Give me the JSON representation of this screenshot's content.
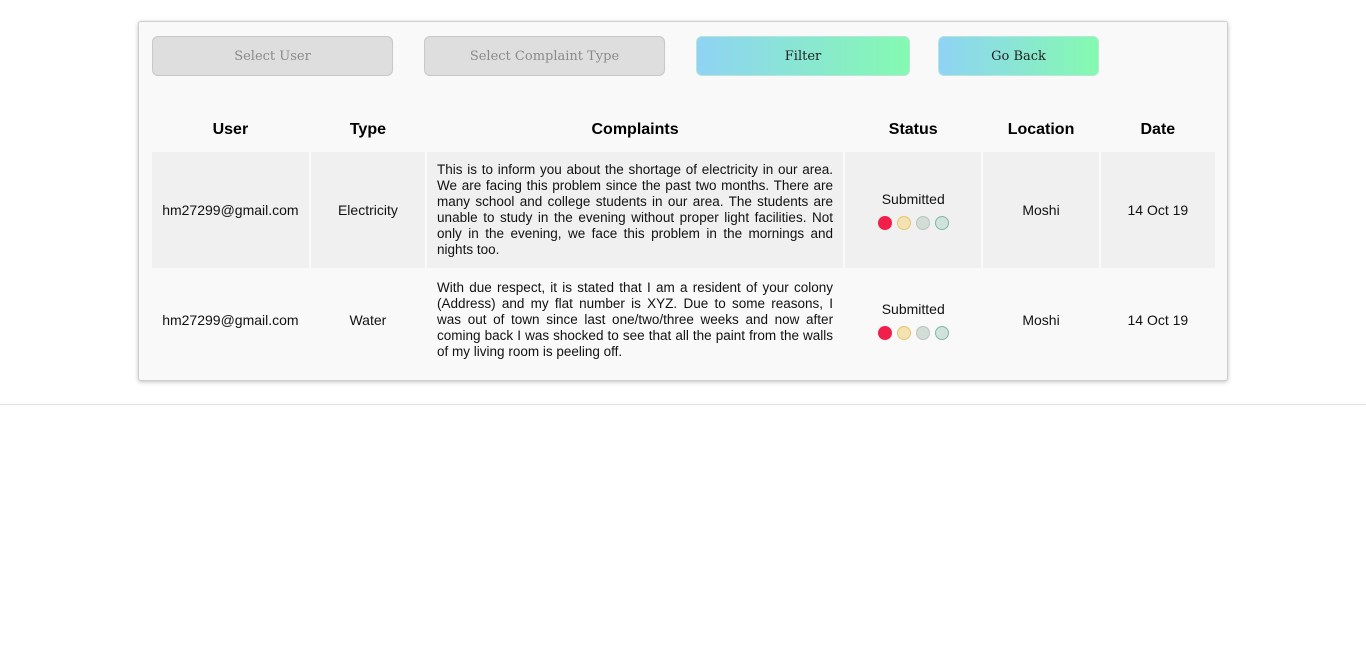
{
  "toolbar": {
    "select_user_label": "Select User",
    "select_type_label": "Select Complaint Type",
    "filter_label": "Filter",
    "go_back_label": "Go Back"
  },
  "table": {
    "headers": [
      "User",
      "Type",
      "Complaints",
      "Status",
      "Location",
      "Date"
    ],
    "rows": [
      {
        "user": "hm27299@gmail.com",
        "type": "Electricity",
        "complaint": "This is to inform you about the shortage of electricity in our area. We are facing this problem since the past two months. There are many school and college students in our area. The students are unable to study in the evening without proper light facilities. Not only in the evening, we face this problem in the mornings and nights too.",
        "status": "Submitted",
        "location": "Moshi",
        "date": "14 Oct 19"
      },
      {
        "user": "hm27299@gmail.com",
        "type": "Water",
        "complaint": "With due respect, it is stated that I am a resident of your colony (Address) and my flat number is XYZ. Due to some reasons, I was out of town since last one/two/three weeks and now after coming back I was shocked to see that all the paint from the walls of my living room is peeling off.",
        "status": "Submitted",
        "location": "Moshi",
        "date": "14 Oct 19"
      }
    ]
  },
  "status_colors": {
    "submitted": "#f0204b",
    "stage2": "#f4e2b3",
    "stage3": "#d4dcd8",
    "stage4": "#cfe3dc"
  },
  "colors": {
    "button_gradient_start": "#8fd3f4",
    "button_gradient_end": "#84fab0"
  }
}
